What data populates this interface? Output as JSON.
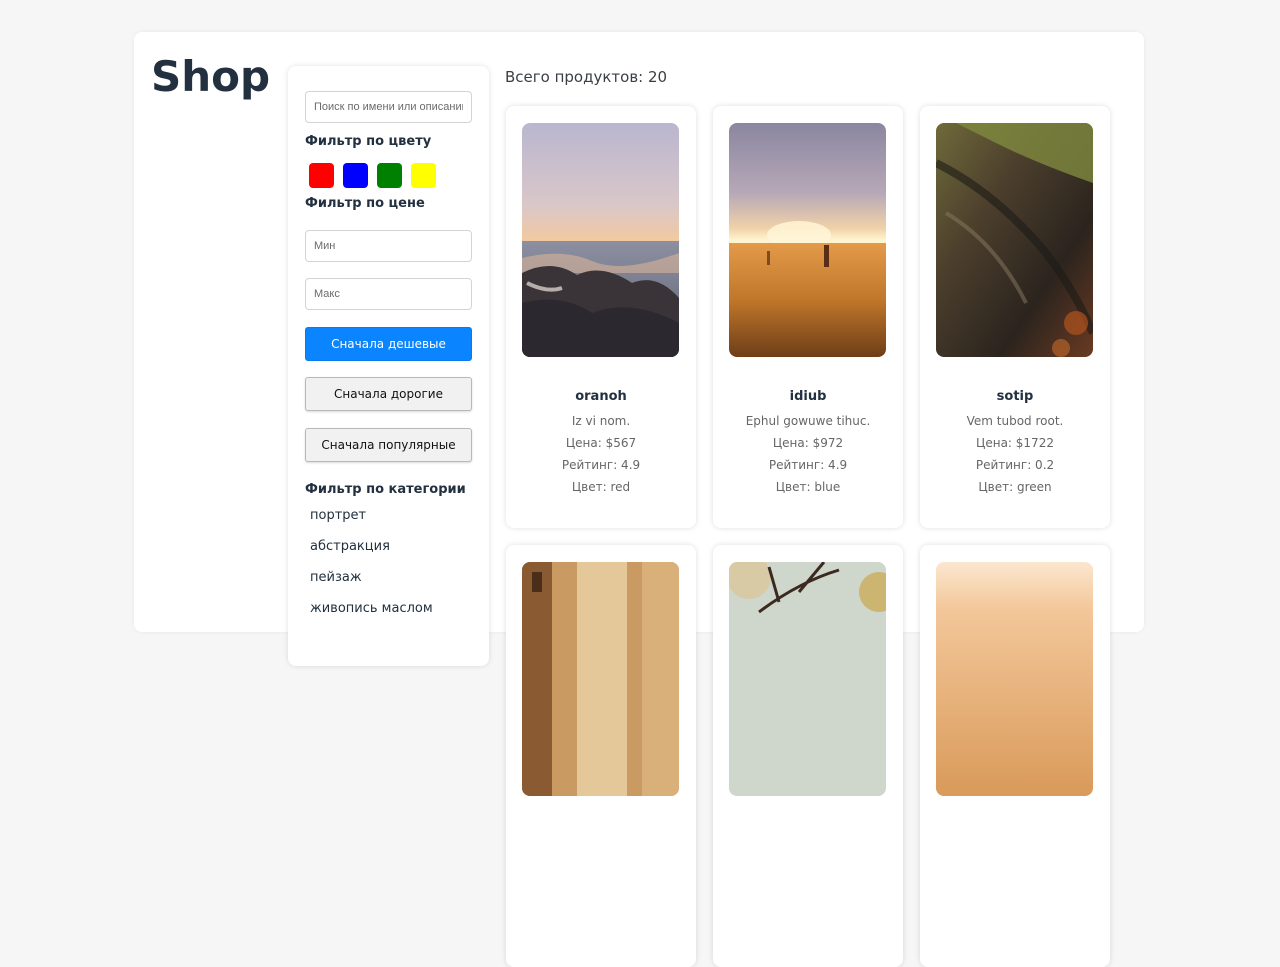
{
  "brand": "Shop",
  "sidebar": {
    "search_placeholder": "Поиск по имени или описанию",
    "color_filter_title": "Фильтр по цвету",
    "colors": [
      "#ff0000",
      "#0000ff",
      "#008000",
      "#ffff00"
    ],
    "price_filter_title": "Фильтр по цене",
    "min_placeholder": "Мин",
    "max_placeholder": "Макс",
    "sort_cheap": "Сначала дешевые",
    "sort_expensive": "Сначала дорогие",
    "sort_popular": "Сначала популярные",
    "category_title": "Фильтр по категории",
    "categories": [
      "портрет",
      "абстракция",
      "пейзаж",
      "живопись маслом"
    ]
  },
  "main": {
    "total": "Всего продуктов: 20",
    "products": [
      {
        "name": "oranoh",
        "desc": "Iz vi nom.",
        "price": "Цена: $567",
        "rating": "Рейтинг: 4.9",
        "color": "Цвет: red",
        "image": "sea-rocks-sunset"
      },
      {
        "name": "idiub",
        "desc": "Ephul gowuwe tihuc.",
        "price": "Цена: $972",
        "rating": "Рейтинг: 4.9",
        "color": "Цвет: blue",
        "image": "field-sunset"
      },
      {
        "name": "sotip",
        "desc": "Vem tubod root.",
        "price": "Цена: $1722",
        "rating": "Рейтинг: 0.2",
        "color": "Цвет: green",
        "image": "mossy-log"
      },
      {
        "image": "old-street"
      },
      {
        "image": "bare-branches"
      },
      {
        "image": "warm-blur"
      }
    ]
  }
}
